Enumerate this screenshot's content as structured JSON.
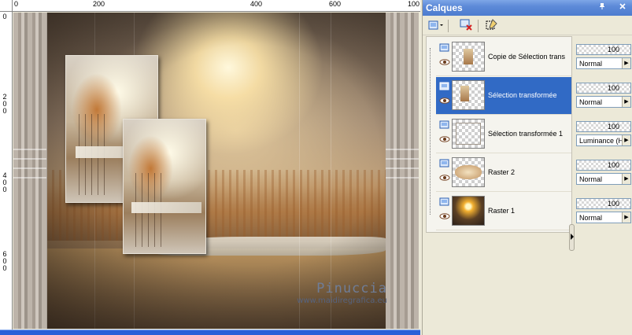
{
  "ruler": {
    "top_labels": [
      "0",
      "200",
      "400",
      "600",
      "800",
      "100"
    ],
    "left_labels": [
      "0",
      "200",
      "400",
      "600"
    ]
  },
  "canvas": {
    "watermark_name": "Pinuccia",
    "watermark_url": "www.maidiregrafica.eu"
  },
  "palette": {
    "title": "Calques",
    "pin_icon": "pin-icon",
    "close_icon": "close-icon",
    "toolbar": [
      {
        "name": "new-layer-button",
        "icon": "new-layer-icon"
      },
      {
        "name": "delete-layer-button",
        "icon": "delete-layer-icon"
      },
      {
        "name": "edit-selection-button",
        "icon": "edit-selection-icon"
      }
    ],
    "layers": [
      {
        "name": "Copie de Sélection trans",
        "opacity": "100",
        "blend": "Normal",
        "selected": false
      },
      {
        "name": "Sélection transformée",
        "opacity": "100",
        "blend": "Normal",
        "selected": true
      },
      {
        "name": "Sélection transformée 1",
        "opacity": "100",
        "blend": "Luminance (H)",
        "selected": false
      },
      {
        "name": "Raster 2",
        "opacity": "100",
        "blend": "Normal",
        "selected": false
      },
      {
        "name": "Raster 1",
        "opacity": "100",
        "blend": "Normal",
        "selected": false
      }
    ]
  },
  "colors": {
    "title_bar": "#5d8ad8",
    "selection": "#316ac5",
    "panel_bg": "#ece9d8",
    "watermark": "#6f7d97"
  }
}
